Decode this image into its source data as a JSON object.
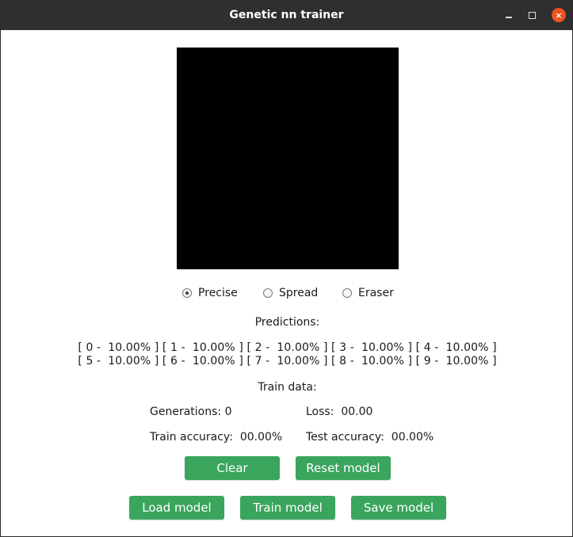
{
  "window": {
    "title": "Genetic nn trainer",
    "controls": {
      "close_icon": "×"
    }
  },
  "draw_modes": [
    {
      "label": "Precise",
      "selected": true
    },
    {
      "label": "Spread",
      "selected": false
    },
    {
      "label": "Eraser",
      "selected": false
    }
  ],
  "predictions": {
    "heading": "Predictions:",
    "line1": "[ 0 -  10.00% ] [ 1 -  10.00% ] [ 2 -  10.00% ] [ 3 -  10.00% ] [ 4 -  10.00% ]",
    "line2": "[ 5 -  10.00% ] [ 6 -  10.00% ] [ 7 -  10.00% ] [ 8 -  10.00% ] [ 9 -  10.00% ]"
  },
  "train": {
    "heading": "Train data:",
    "generations_label": "Generations:",
    "generations_value": "0",
    "loss_label": "Loss:",
    "loss_value": "00.00",
    "train_accuracy_label": "Train accuracy:",
    "train_accuracy_value": "00.00%",
    "test_accuracy_label": "Test accuracy:",
    "test_accuracy_value": "00.00%"
  },
  "buttons": {
    "clear": "Clear",
    "reset_model": "Reset model",
    "load_model": "Load model",
    "train_model": "Train model",
    "save_model": "Save model"
  },
  "colors": {
    "titlebar": "#2f2f2f",
    "button": "#3aa55d",
    "close": "#e95420",
    "canvas": "#000000"
  }
}
